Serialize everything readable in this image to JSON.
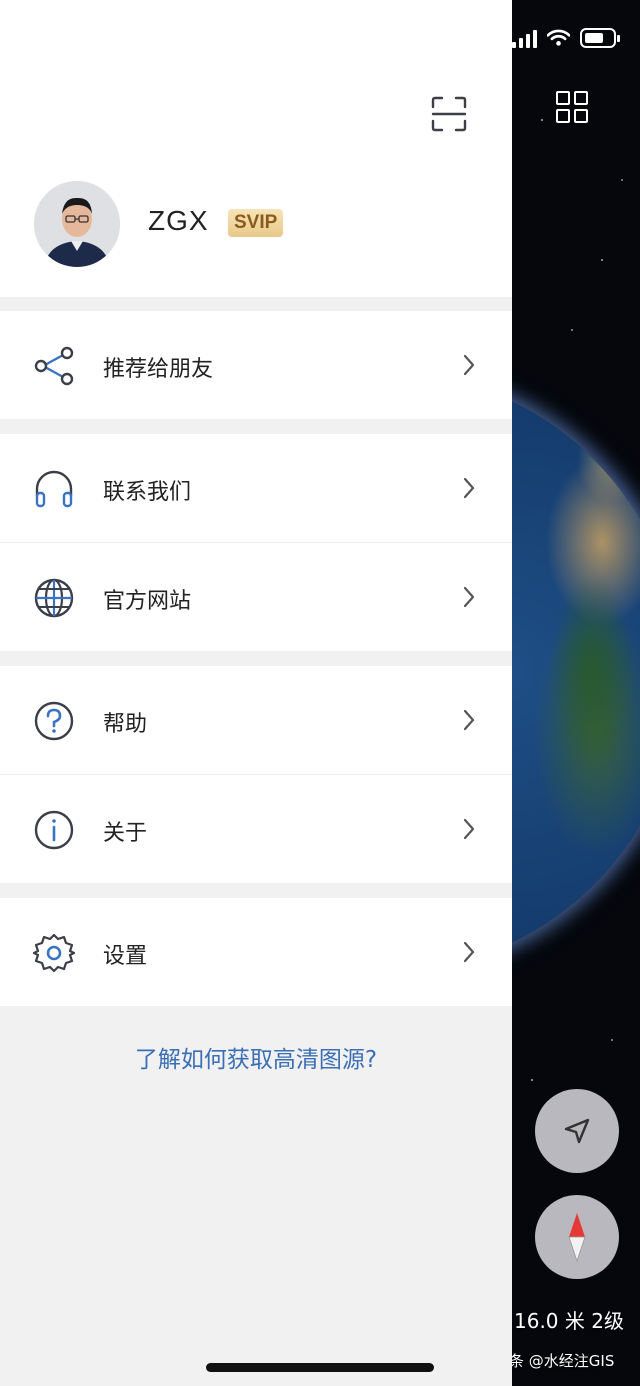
{
  "profile": {
    "username": "ZGX",
    "badge": "SVIP",
    "scan_icon": "scan-icon",
    "avatar": "avatar"
  },
  "menu_groups": [
    {
      "items": [
        {
          "label": "推荐给朋友",
          "icon": "share-icon"
        }
      ]
    },
    {
      "items": [
        {
          "label": "联系我们",
          "icon": "headphones-icon"
        },
        {
          "label": "官方网站",
          "icon": "globe-icon"
        }
      ]
    },
    {
      "items": [
        {
          "label": "帮助",
          "icon": "help-icon"
        },
        {
          "label": "关于",
          "icon": "info-icon"
        }
      ]
    },
    {
      "items": [
        {
          "label": "设置",
          "icon": "gear-icon"
        }
      ]
    }
  ],
  "footer_link": "了解如何获取高清图源?",
  "map": {
    "scale_text": "16.0 米 2级",
    "watermark": "头条 @水经注GIS"
  },
  "colors": {
    "accent": "#3a6fb5",
    "icon_line": "#3b3f48",
    "icon_accent": "#3a73c4",
    "badge_bg": "#f0d7a1",
    "compass_red": "#e53935"
  }
}
